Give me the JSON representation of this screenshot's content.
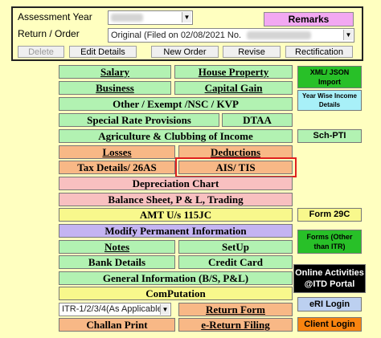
{
  "header": {
    "assessment_year_label": "Assessment Year",
    "return_order_label": "Return / Order",
    "return_order_value": "Original (Filed on 02/08/2021 No.",
    "remarks_label": "Remarks"
  },
  "toolbar": {
    "delete_label": "Delete",
    "edit_details_label": "Edit Details",
    "new_order_label": "New Order",
    "revise_label": "Revise",
    "rectification_label": "Rectification"
  },
  "menu": {
    "salary": "Salary",
    "house_property": "House Property",
    "business": "Business",
    "capital_gain": "Capital Gain",
    "other_exempt": "Other / Exempt /NSC / KVP",
    "special_rate": "Special Rate Provisions",
    "dtaa": "DTAA",
    "agriculture": "Agriculture & Clubbing of Income",
    "losses": "Losses",
    "deductions": "Deductions",
    "tax_details": "Tax Details/ 26AS",
    "ais_tis": "AIS/ TIS",
    "depreciation": "Depreciation Chart",
    "balance_sheet": "Balance Sheet, P & L, Trading",
    "amt": "AMT U/s 115JC",
    "modify_permanent": "Modify Permanent Information",
    "notes": "Notes",
    "setup": "SetUp",
    "bank_details": "Bank Details",
    "credit_card": "Credit Card",
    "general_info": "General Information (B/S, P&L)",
    "computation": "ComPutation",
    "itr_select": "ITR-1/2/3/4(As Applicable)",
    "return_form": "Return Form",
    "challan_print": "Challan Print",
    "e_return_filing": "e-Return Filing"
  },
  "side": {
    "xml_json_import": "XML/ JSON Import",
    "year_wise_income": "Year Wise Income Details",
    "sch_pti": "Sch-PTI",
    "form_29c": "Form 29C",
    "forms_other": "Forms (Other than ITR)",
    "online_activities": "Online Activities @ITD Portal",
    "eri_login": "eRI Login",
    "client_login": "Client Login"
  },
  "colors": {
    "background": "#ffffc0",
    "green": "#b2f2b2",
    "orange": "#f8b886",
    "pink": "#f8c0c0",
    "yellow": "#f8f88c",
    "lavender": "#c4b4f2",
    "highlight": "#e02020"
  }
}
